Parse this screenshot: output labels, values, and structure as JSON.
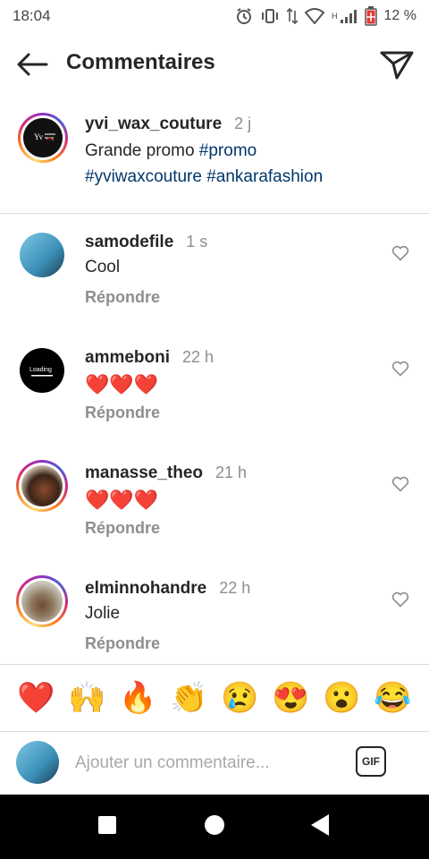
{
  "status_bar": {
    "time": "18:04",
    "network": "H",
    "battery": "12 %"
  },
  "header": {
    "title": "Commentaires"
  },
  "caption": {
    "username": "yvi_wax_couture",
    "time": "2 j",
    "text_line1": "Grande promo ",
    "tag_promo": "#promo",
    "tag_yvi": "#yviwaxcouture",
    "tag_ankara": "#ankarafashion"
  },
  "comments": [
    {
      "username": "samodefile",
      "time": "1 s",
      "text": "Cool",
      "reply": "Répondre"
    },
    {
      "username": "ammeboni",
      "time": "22 h",
      "text": "❤️❤️❤️",
      "reply": "Répondre"
    },
    {
      "username": "manasse_theo",
      "time": "21 h",
      "text": "❤️❤️❤️",
      "reply": "Répondre"
    },
    {
      "username": "elminnohandre",
      "time": "22 h",
      "text": "Jolie",
      "reply": "Répondre"
    }
  ],
  "quick_reactions": [
    "❤️",
    "🙌",
    "🔥",
    "👏",
    "😢",
    "😍",
    "😮",
    "😂"
  ],
  "composer": {
    "placeholder": "Ajouter un commentaire...",
    "gif_label": "GIF"
  },
  "colors": {
    "hashtag": "#00376b",
    "muted": "#8e8e8e",
    "text": "#262626"
  }
}
